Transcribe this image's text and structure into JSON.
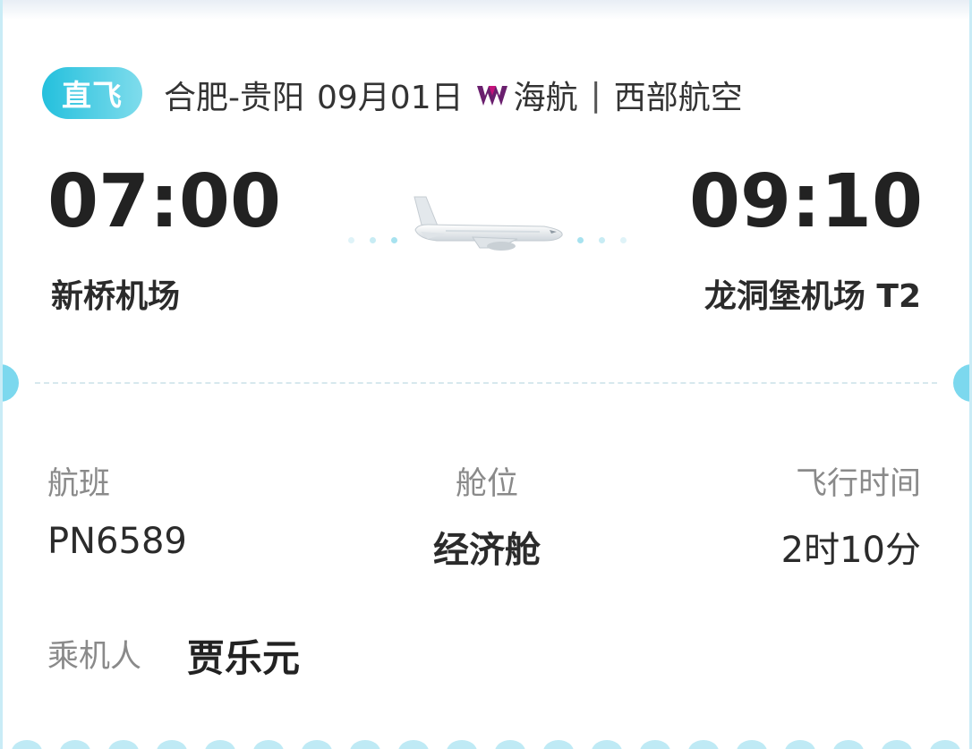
{
  "colors": {
    "accent": "#24c0dd",
    "notch": "#7cd8ee",
    "airline_logo": "#6a1f6e"
  },
  "header": {
    "badge": "直飞",
    "route": "合肥-贵阳",
    "date": "09月01日",
    "airline_logo_icon": "hna-logo-icon",
    "airline": "海航",
    "separator": "|",
    "operator": "西部航空"
  },
  "departure": {
    "time": "07:00",
    "airport": "新桥机场"
  },
  "arrival": {
    "time": "09:10",
    "airport": "龙洞堡机场 T2"
  },
  "details": {
    "flight_label": "航班",
    "flight_value": "PN6589",
    "cabin_label": "舱位",
    "cabin_value": "经济舱",
    "duration_label": "飞行时间",
    "duration_value": "2时10分"
  },
  "passenger": {
    "label": "乘机人",
    "name": "贾乐元"
  }
}
